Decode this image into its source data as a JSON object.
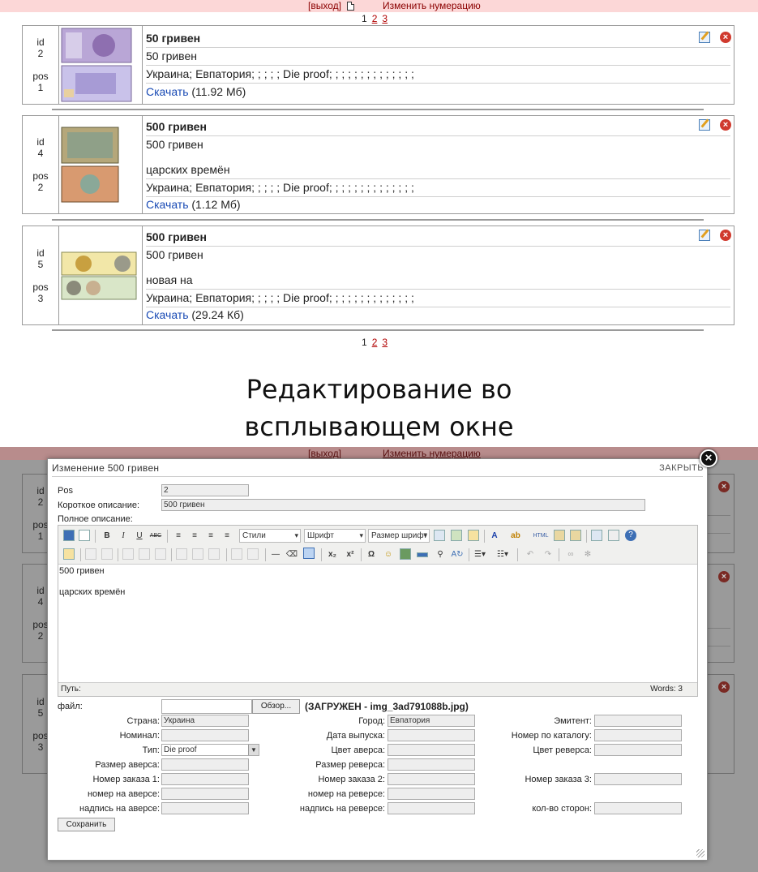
{
  "topbar": {
    "exit_label": "[выход]",
    "renumber_label": "Изменить нумерацию"
  },
  "pager": {
    "current": "1",
    "pages": [
      "2",
      "3"
    ]
  },
  "labels": {
    "id": "id",
    "pos": "pos",
    "download": "Скачать"
  },
  "cards": [
    {
      "id": "2",
      "pos": "1",
      "title": "50 гривен",
      "short": "50 гривен",
      "full": "",
      "props": "Украина; Евпатория; ;  ; ; ;   Die proof; ; ;  ; ; ;  ; ; ;  ; ; ;  ; ;",
      "size": "(11.92 Мб)"
    },
    {
      "id": "4",
      "pos": "2",
      "title": "500 гривен",
      "short": "500 гривен",
      "full": "царских времён",
      "props": "Украина; Евпатория; ;  ; ; ;   Die proof; ; ;  ; ; ;  ; ; ;  ; ; ;  ; ;",
      "size": "(1.12 Мб)"
    },
    {
      "id": "5",
      "pos": "3",
      "title": "500 гривен",
      "short": "500 гривен",
      "full": "новая на",
      "props": "Украина; Евпатория; ;  ; ; ;   Die proof; ; ;  ; ; ;  ; ; ;  ; ; ;  ; ;",
      "size": "(29.24 Кб)"
    }
  ],
  "caption": {
    "line1": "Редактирование во",
    "line2": "всплывающем окне"
  },
  "modal": {
    "title": "Изменение 500 гривен",
    "close_label": "ЗАКРЫТЬ",
    "pos_label": "Pos",
    "pos_value": "2",
    "short_label": "Короткое описание:",
    "short_value": "500 гривен",
    "full_label": "Полное описание:",
    "toolbar": {
      "styles": "Стили",
      "font": "Шрифт",
      "size": "Размер шрифт",
      "bold": "B",
      "italic": "I",
      "underline": "U",
      "strike": "ABC",
      "html": "HTML",
      "omega": "Ω",
      "sub": "x₂",
      "sup": "x²"
    },
    "editor_lines": [
      "500 гривен",
      "царских времён"
    ],
    "path_label": "Путь:",
    "words": "Words: 3",
    "file_label": "файл:",
    "browse_label": "Обзор...",
    "uploaded": "(ЗАГРУЖЕН - img_3ad791088b.jpg)",
    "fields": {
      "country": {
        "label": "Страна:",
        "value": "Украина"
      },
      "city": {
        "label": "Город:",
        "value": "Евпатория"
      },
      "issuer": {
        "label": "Эмитент:",
        "value": ""
      },
      "nominal": {
        "label": "Номинал:",
        "value": ""
      },
      "issue_date": {
        "label": "Дата выпуска:",
        "value": ""
      },
      "catalog_no": {
        "label": "Номер по каталогу:",
        "value": ""
      },
      "type": {
        "label": "Тип:",
        "value": "Die proof"
      },
      "obverse_color": {
        "label": "Цвет аверса:",
        "value": ""
      },
      "reverse_color": {
        "label": "Цвет реверса:",
        "value": ""
      },
      "obverse_size": {
        "label": "Размер аверса:",
        "value": ""
      },
      "reverse_size": {
        "label": "Размер реверса:",
        "value": ""
      },
      "order1": {
        "label": "Номер заказа 1:",
        "value": ""
      },
      "order2": {
        "label": "Номер заказа 2:",
        "value": ""
      },
      "order3": {
        "label": "Номер заказа 3:",
        "value": ""
      },
      "obverse_number": {
        "label": "номер на аверсе:",
        "value": ""
      },
      "reverse_number": {
        "label": "номер на реверсе:",
        "value": ""
      },
      "obverse_inscription": {
        "label": "надпись на аверсе:",
        "value": ""
      },
      "reverse_inscription": {
        "label": "надпись на реверсе:",
        "value": ""
      },
      "sides_count": {
        "label": "кол-во сторон:",
        "value": ""
      }
    },
    "save_label": "Сохранить"
  },
  "ghost": {
    "ids": [
      "2",
      "4",
      "5"
    ],
    "pos": [
      "1",
      "2",
      "3"
    ]
  },
  "colors": {
    "topbar": "#fcd7d7",
    "link_red": "#b10000",
    "link_blue": "#1a4bb5",
    "overlay": "#9a9a9a",
    "delete": "#d03a2e"
  }
}
